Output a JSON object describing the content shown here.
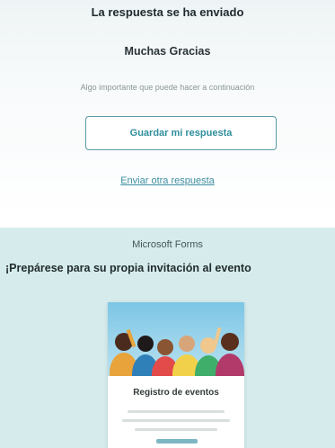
{
  "confirmation": {
    "title": "La respuesta se ha enviado",
    "thanks": "Muchas Gracias",
    "hint": "Algo importante que puede hacer a continuación",
    "save_button": "Guardar mi respuesta",
    "another_link": "Enviar otra respuesta"
  },
  "promo": {
    "brand": "Microsoft Forms",
    "headline": "¡Prepárese para su propia invitación al evento",
    "card_title": "Registro de eventos"
  },
  "colors": {
    "accent": "#2f8f9c",
    "promo_bg": "#d6ecec"
  }
}
